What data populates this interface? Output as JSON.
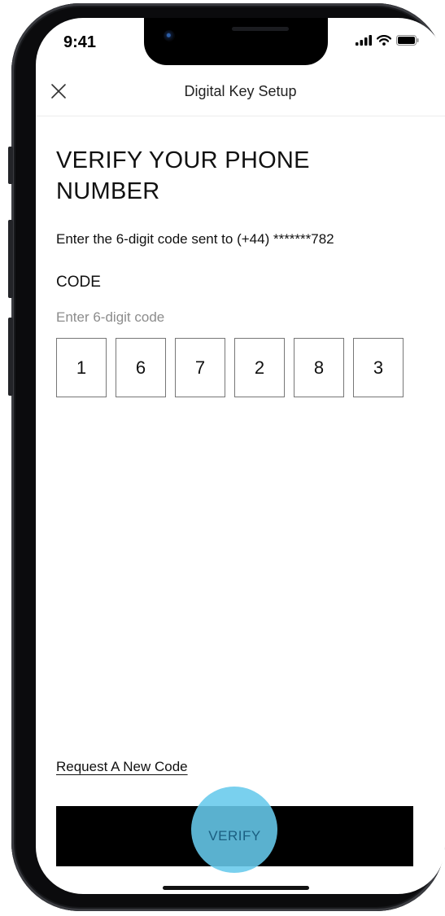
{
  "status_bar": {
    "time": "9:41",
    "icons": [
      "signal-icon",
      "wifi-icon",
      "battery-icon"
    ]
  },
  "nav": {
    "title": "Digital Key Setup",
    "close_icon": "close-icon"
  },
  "page": {
    "heading": "VERIFY YOUR PHONE NUMBER",
    "subtext": "Enter the 6-digit code sent to (+44) *******782",
    "code_label": "CODE",
    "code_hint": "Enter 6-digit code",
    "digits": [
      "1",
      "6",
      "7",
      "2",
      "8",
      "3"
    ]
  },
  "actions": {
    "request_new_code": "Request A New Code",
    "verify": "VERIFY"
  },
  "colors": {
    "primary_button": "#000000",
    "tap_highlight": "#66C9EC",
    "text": "#111111",
    "hint_text": "#8C8C8C"
  }
}
